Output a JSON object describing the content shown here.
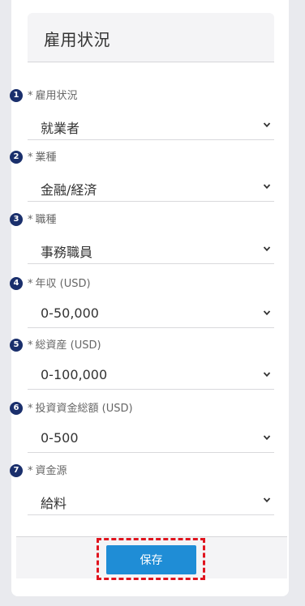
{
  "colors": {
    "badge": "#1a2f6c",
    "primary_button": "#1f8dd6",
    "highlight": "#e0141e"
  },
  "section": {
    "title": "雇用状況"
  },
  "fields": [
    {
      "number": "1",
      "required_mark": "*",
      "label": "雇用状況",
      "value": "就業者",
      "icon": "chevron-down-icon"
    },
    {
      "number": "2",
      "required_mark": "*",
      "label": "業種",
      "value": "金融/経済",
      "icon": "chevron-down-icon"
    },
    {
      "number": "3",
      "required_mark": "*",
      "label": "職種",
      "value": "事務職員",
      "icon": "chevron-down-icon"
    },
    {
      "number": "4",
      "required_mark": "*",
      "label": "年収 (USD)",
      "value": "0-50,000",
      "icon": "chevron-down-icon"
    },
    {
      "number": "5",
      "required_mark": "*",
      "label": "総資産 (USD)",
      "value": "0-100,000",
      "icon": "chevron-down-icon"
    },
    {
      "number": "6",
      "required_mark": "*",
      "label": "投資資金総額 (USD)",
      "value": "0-500",
      "icon": "chevron-down-icon"
    },
    {
      "number": "7",
      "required_mark": "*",
      "label": "資金源",
      "value": "給料",
      "icon": "chevron-down-icon"
    }
  ],
  "footer": {
    "save_label": "保存"
  }
}
